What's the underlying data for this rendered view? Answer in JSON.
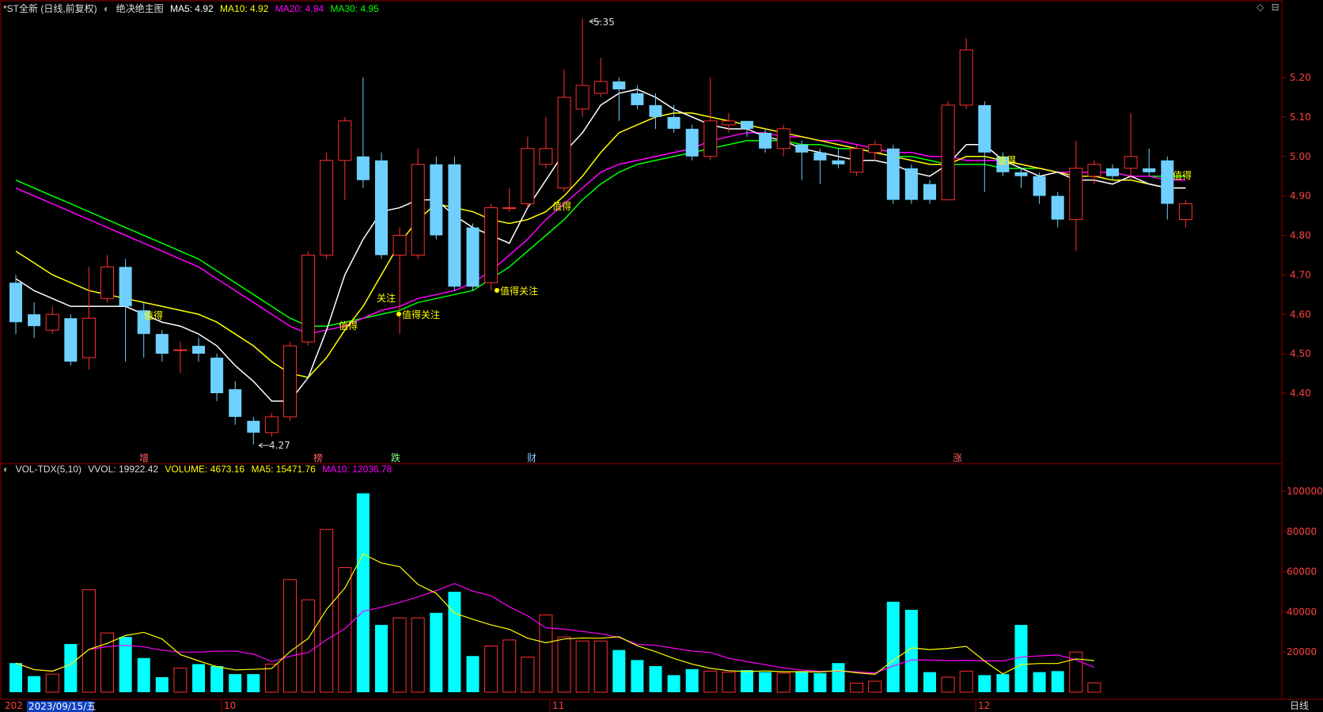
{
  "header": {
    "title": "*ST全新 (日线,前复权)",
    "indicator_name": "绝决绝主图",
    "ma5": "MA5: 4.92",
    "ma10": "MA10: 4.92",
    "ma20": "MA20: 4.94",
    "ma30": "MA30: 4.95"
  },
  "vol_header": {
    "name": "VOL-TDX(5,10)",
    "vvol": "VVOL: 19922.42",
    "volume": "VOLUME: 4673.16",
    "ma5": "MA5: 15471.76",
    "ma10": "MA10: 12036.78"
  },
  "price_axis": [
    "5.20",
    "5.10",
    "5.00",
    "4.90",
    "4.80",
    "4.70",
    "4.60",
    "4.50",
    "4.40"
  ],
  "vol_axis": [
    "100000",
    "80000",
    "60000",
    "40000",
    "20000"
  ],
  "markers": {
    "high": "5.35",
    "low": "4.27"
  },
  "event_tags": [
    "增",
    "榜",
    "跌",
    "财",
    "涨"
  ],
  "signals": [
    "值得",
    "关注",
    "值得",
    "值得关注",
    "值得关注",
    "值得",
    "值得",
    "值得"
  ],
  "date_axis": {
    "cursor_date": "2023/09/15/五",
    "left_partial": "202",
    "months": [
      "10",
      "11",
      "12"
    ]
  },
  "period_label": "日线",
  "colors": {
    "up": "#ff3030",
    "down": "#6fd0ff",
    "vol_down": "#00ffff",
    "ma5": "#ffffff",
    "ma10": "#ffff00",
    "ma20": "#ff00ff",
    "ma30": "#00ff00"
  },
  "chart_data": {
    "type": "candlestick",
    "ylim": [
      4.2,
      5.4
    ],
    "candles": [
      [
        4.68,
        4.58,
        4.7,
        4.55
      ],
      [
        4.6,
        4.57,
        4.63,
        4.54
      ],
      [
        4.56,
        4.6,
        4.62,
        4.55
      ],
      [
        4.59,
        4.48,
        4.6,
        4.47
      ],
      [
        4.49,
        4.59,
        4.72,
        4.46
      ],
      [
        4.64,
        4.72,
        4.75,
        4.63
      ],
      [
        4.72,
        4.62,
        4.74,
        4.48
      ],
      [
        4.61,
        4.55,
        4.63,
        4.49
      ],
      [
        4.55,
        4.5,
        4.56,
        4.48
      ],
      [
        4.51,
        4.51,
        4.53,
        4.45
      ],
      [
        4.52,
        4.5,
        4.54,
        4.48
      ],
      [
        4.49,
        4.4,
        4.5,
        4.38
      ],
      [
        4.41,
        4.34,
        4.43,
        4.32
      ],
      [
        4.33,
        4.3,
        4.34,
        4.27
      ],
      [
        4.3,
        4.34,
        4.35,
        4.29
      ],
      [
        4.34,
        4.52,
        4.53,
        4.33
      ],
      [
        4.53,
        4.75,
        4.76,
        4.52
      ],
      [
        4.75,
        4.99,
        5.01,
        4.74
      ],
      [
        4.99,
        5.09,
        5.1,
        4.89
      ],
      [
        5.0,
        4.94,
        5.2,
        4.92
      ],
      [
        4.99,
        4.75,
        5.01,
        4.74
      ],
      [
        4.75,
        4.8,
        4.82,
        4.55
      ],
      [
        4.75,
        4.98,
        5.02,
        4.74
      ],
      [
        4.98,
        4.8,
        5.0,
        4.79
      ],
      [
        4.98,
        4.67,
        5.0,
        4.66
      ],
      [
        4.82,
        4.67,
        4.83,
        4.66
      ],
      [
        4.68,
        4.87,
        4.88,
        4.66
      ],
      [
        4.87,
        4.87,
        4.92,
        4.86
      ],
      [
        4.88,
        5.02,
        5.05,
        4.87
      ],
      [
        4.98,
        5.02,
        5.1,
        4.97
      ],
      [
        4.92,
        5.15,
        5.22,
        4.91
      ],
      [
        5.12,
        5.18,
        5.35,
        5.1
      ],
      [
        5.16,
        5.19,
        5.25,
        5.15
      ],
      [
        5.19,
        5.17,
        5.2,
        5.09
      ],
      [
        5.16,
        5.13,
        5.18,
        5.12
      ],
      [
        5.13,
        5.1,
        5.16,
        5.07
      ],
      [
        5.1,
        5.07,
        5.13,
        5.06
      ],
      [
        5.07,
        5.0,
        5.08,
        4.99
      ],
      [
        5.0,
        5.09,
        5.2,
        4.99
      ],
      [
        5.08,
        5.09,
        5.11,
        5.06
      ],
      [
        5.09,
        5.07,
        5.09,
        5.05
      ],
      [
        5.06,
        5.02,
        5.07,
        5.01
      ],
      [
        5.02,
        5.07,
        5.08,
        5.0
      ],
      [
        5.03,
        5.01,
        5.04,
        4.94
      ],
      [
        5.01,
        4.99,
        5.02,
        4.93
      ],
      [
        4.99,
        4.98,
        5.02,
        4.97
      ],
      [
        4.96,
        5.02,
        5.03,
        4.95
      ],
      [
        5.01,
        5.03,
        5.04,
        4.99
      ],
      [
        5.02,
        4.89,
        5.03,
        4.88
      ],
      [
        4.97,
        4.89,
        4.98,
        4.88
      ],
      [
        4.93,
        4.89,
        4.94,
        4.88
      ],
      [
        4.89,
        5.13,
        5.14,
        4.89
      ],
      [
        5.13,
        5.27,
        5.3,
        5.12
      ],
      [
        5.13,
        5.01,
        5.14,
        4.91
      ],
      [
        5.0,
        4.96,
        5.01,
        4.95
      ],
      [
        4.96,
        4.95,
        4.97,
        4.92
      ],
      [
        4.95,
        4.9,
        4.96,
        4.88
      ],
      [
        4.9,
        4.84,
        4.91,
        4.82
      ],
      [
        4.84,
        4.97,
        5.04,
        4.76
      ],
      [
        4.95,
        4.98,
        4.99,
        4.93
      ],
      [
        4.97,
        4.95,
        4.98,
        4.94
      ],
      [
        4.97,
        5.0,
        5.11,
        4.94
      ],
      [
        4.97,
        4.96,
        5.02,
        4.95
      ],
      [
        4.99,
        4.88,
        5.0,
        4.84
      ],
      [
        4.84,
        4.88,
        4.89,
        4.82
      ]
    ],
    "volume": [
      14500,
      8000,
      9000,
      24000,
      51000,
      29500,
      27500,
      17000,
      7500,
      12000,
      14000,
      13000,
      9000,
      9000,
      14000,
      56000,
      46000,
      81000,
      62000,
      99000,
      33500,
      37000,
      37000,
      39500,
      50000,
      18000,
      23000,
      26000,
      17500,
      38500,
      27500,
      25500,
      25500,
      21000,
      16000,
      13000,
      8500,
      11500,
      10500,
      10000,
      11000,
      10000,
      9500,
      10500,
      9500,
      14500,
      4500,
      5500,
      45000,
      41000,
      10000,
      7500,
      10500,
      8500,
      9000,
      33500,
      10000,
      10500,
      20000,
      4673
    ],
    "ma5": [
      4.69,
      4.66,
      4.64,
      4.62,
      4.62,
      4.62,
      4.62,
      4.6,
      4.58,
      4.57,
      4.55,
      4.52,
      4.47,
      4.43,
      4.38,
      4.38,
      4.44,
      4.56,
      4.7,
      4.79,
      4.86,
      4.87,
      4.89,
      4.89,
      4.85,
      4.82,
      4.8,
      4.78,
      4.87,
      4.94,
      5.01,
      5.06,
      5.13,
      5.16,
      5.17,
      5.15,
      5.12,
      5.1,
      5.08,
      5.07,
      5.07,
      5.05,
      5.04,
      5.02,
      5.01,
      5.0,
      4.99,
      4.99,
      4.98,
      4.96,
      4.95,
      4.98,
      5.03,
      5.03,
      4.99,
      4.97,
      4.95,
      4.96,
      4.94,
      4.94,
      4.93,
      4.95,
      4.93,
      4.92,
      4.92
    ],
    "ma10": [
      4.76,
      4.73,
      4.7,
      4.68,
      4.66,
      4.65,
      4.64,
      4.63,
      4.62,
      4.61,
      4.6,
      4.58,
      4.55,
      4.52,
      4.48,
      4.45,
      4.44,
      4.49,
      4.56,
      4.62,
      4.7,
      4.78,
      4.84,
      4.88,
      4.87,
      4.86,
      4.84,
      4.83,
      4.84,
      4.86,
      4.9,
      4.95,
      5.01,
      5.06,
      5.08,
      5.1,
      5.11,
      5.11,
      5.1,
      5.09,
      5.08,
      5.07,
      5.06,
      5.05,
      5.04,
      5.03,
      5.02,
      5.01,
      5.0,
      4.99,
      4.98,
      4.98,
      5.0,
      5.0,
      4.99,
      4.98,
      4.97,
      4.96,
      4.95,
      4.95,
      4.94,
      4.94,
      4.93,
      4.92,
      4.92
    ],
    "ma20": [
      4.92,
      4.9,
      4.88,
      4.86,
      4.84,
      4.82,
      4.8,
      4.78,
      4.76,
      4.74,
      4.72,
      4.69,
      4.66,
      4.63,
      4.6,
      4.57,
      4.55,
      4.56,
      4.57,
      4.59,
      4.61,
      4.62,
      4.64,
      4.65,
      4.66,
      4.68,
      4.71,
      4.75,
      4.79,
      4.84,
      4.88,
      4.92,
      4.96,
      4.98,
      4.99,
      5.0,
      5.01,
      5.02,
      5.04,
      5.05,
      5.06,
      5.06,
      5.05,
      5.05,
      5.04,
      5.04,
      5.03,
      5.02,
      5.01,
      5.01,
      5.0,
      5.0,
      4.99,
      4.99,
      4.99,
      4.98,
      4.97,
      4.96,
      4.96,
      4.96,
      4.96,
      4.95,
      4.95,
      4.94,
      4.94
    ],
    "ma30": [
      4.94,
      4.92,
      4.9,
      4.88,
      4.86,
      4.84,
      4.82,
      4.8,
      4.78,
      4.76,
      4.74,
      4.71,
      4.68,
      4.65,
      4.62,
      4.59,
      4.57,
      4.57,
      4.58,
      4.59,
      4.6,
      4.61,
      4.63,
      4.64,
      4.65,
      4.66,
      4.69,
      4.72,
      4.76,
      4.8,
      4.84,
      4.89,
      4.93,
      4.96,
      4.98,
      4.99,
      5.0,
      5.01,
      5.02,
      5.03,
      5.04,
      5.04,
      5.04,
      5.03,
      5.03,
      5.02,
      5.02,
      5.01,
      5.0,
      5.0,
      4.99,
      4.98,
      4.98,
      4.98,
      4.97,
      4.97,
      4.97,
      4.96,
      4.96,
      4.96,
      4.96,
      4.95,
      4.95,
      4.95,
      4.95
    ]
  }
}
